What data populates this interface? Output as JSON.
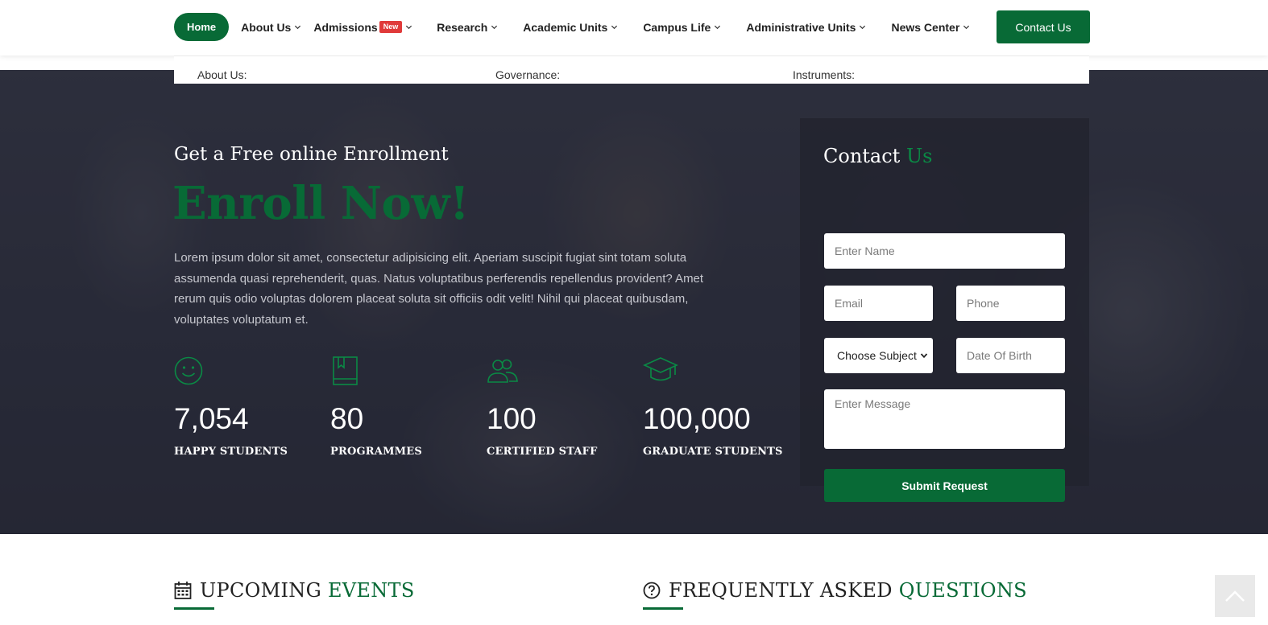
{
  "nav": {
    "items": [
      {
        "label": "Home",
        "active": true,
        "has_dropdown": false
      },
      {
        "label": "About Us",
        "has_dropdown": true
      },
      {
        "label": "Admissions",
        "badge": "New",
        "has_dropdown": true
      },
      {
        "label": "Research",
        "has_dropdown": true
      },
      {
        "label": "Academic Units",
        "has_dropdown": true
      },
      {
        "label": "Campus Life",
        "has_dropdown": true
      },
      {
        "label": "Administrative Units",
        "has_dropdown": true
      },
      {
        "label": "News Center",
        "has_dropdown": true
      }
    ],
    "contact_button": "Contact Us"
  },
  "dropdown": {
    "columns": [
      "About Us:",
      "Governance:",
      "Instruments:"
    ]
  },
  "hero": {
    "subtitle": "Get a Free online Enrollment",
    "title": "Enroll Now!",
    "text": "Lorem ipsum dolor sit amet, consectetur adipisicing elit. Aperiam suscipit fugiat sint totam soluta assumenda quasi reprehenderit, quas. Natus voluptatibus perferendis repellendus provident? Amet rerum quis odio voluptas dolorem placeat soluta sit officiis odit velit! Nihil qui placeat quibusdam, voluptates voluptatum et.",
    "stats": [
      {
        "icon": "smile-icon",
        "value": "7,054",
        "label": "HAPPY STUDENTS"
      },
      {
        "icon": "book-icon",
        "value": "80",
        "label": "PROGRAMMES"
      },
      {
        "icon": "users-icon",
        "value": "100",
        "label": "CERTIFIED STAFF"
      },
      {
        "icon": "graduation-cap-icon",
        "value": "100,000",
        "label": "GRADUATE STUDENTS"
      }
    ]
  },
  "contact_form": {
    "title_main": "Contact",
    "title_accent": "Us",
    "name_placeholder": "Enter Name",
    "email_placeholder": "Email",
    "phone_placeholder": "Phone",
    "subject_value": "Choose Subject",
    "dob_placeholder": "Date Of Birth",
    "message_placeholder": "Enter Message",
    "submit_label": "Submit Request"
  },
  "sections": {
    "events": {
      "main": "UPCOMING",
      "accent": "EVENTS",
      "icon": "calendar-icon"
    },
    "faq": {
      "main": "FREQUENTLY ASKED",
      "accent": "QUESTIONS",
      "icon": "question-circle-icon"
    }
  },
  "colors": {
    "brand_green": "#086a36",
    "badge_red": "#e03a3a",
    "hero_overlay": "#232432"
  }
}
